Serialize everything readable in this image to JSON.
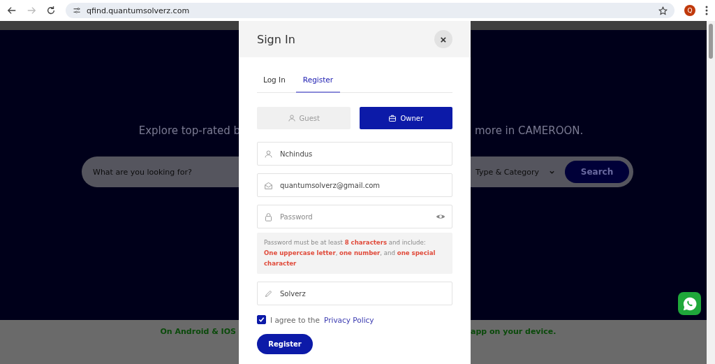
{
  "browser": {
    "url": "qfind.quantumsolverz.com",
    "profile_initial": "Q"
  },
  "hero": {
    "tagline_left": "Explore top-rated b",
    "tagline_right": "more in CAMEROON.",
    "search_placeholder": "What are you looking for?",
    "category": "Type & Category",
    "search_button": "Search"
  },
  "banner": {
    "left": "On Android & IOS",
    "right": "app on your device."
  },
  "modal": {
    "title": "Sign In",
    "close": "×",
    "tabs": [
      {
        "label": "Log In",
        "selected": false
      },
      {
        "label": "Register",
        "selected": true
      }
    ],
    "roles": [
      {
        "label": "Guest",
        "kind": "guest",
        "selected": false
      },
      {
        "label": "Owner",
        "kind": "owner",
        "selected": true
      }
    ],
    "fields": [
      {
        "kind": "user",
        "value": "Nchindus"
      },
      {
        "kind": "email",
        "value": "quantumsolverz@gmail.com"
      },
      {
        "kind": "password",
        "placeholder": "Password"
      }
    ],
    "hint_lines": [
      "Password must be at least **8 characters** and include:",
      "**One uppercase letter**, **one number**, and **one special character**"
    ],
    "extra_field": {
      "kind": "pencil",
      "value": "Solverz"
    },
    "agree": {
      "checked": true,
      "text": "I agree to the",
      "link": "Privacy Policy"
    },
    "submit": "Register"
  }
}
